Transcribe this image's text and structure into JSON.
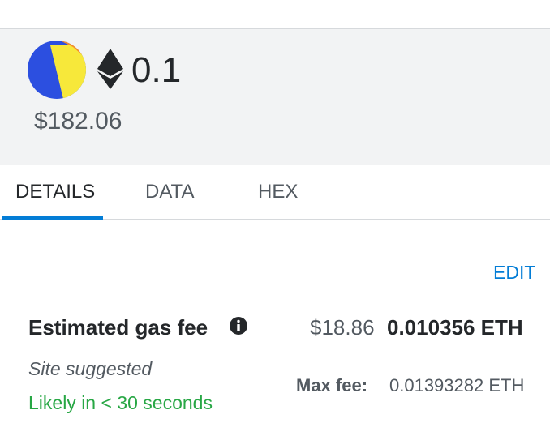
{
  "summary": {
    "eth_amount": "0.1",
    "fiat_amount": "$182.06",
    "avatar_icon": "jazzicon-avatar",
    "currency_icon": "ethereum-icon"
  },
  "tabs": [
    {
      "label": "DETAILS",
      "active": true
    },
    {
      "label": "DATA",
      "active": false
    },
    {
      "label": "HEX",
      "active": false
    }
  ],
  "details": {
    "edit_label": "EDIT",
    "gas_fee_title": "Estimated gas fee",
    "info_icon": "info-icon",
    "gas_fee_fiat": "$18.86",
    "gas_fee_eth": "0.010356 ETH",
    "site_suggested": "Site suggested",
    "likely_time": "Likely in < 30 seconds",
    "max_fee_label": "Max fee:",
    "max_fee_value": "0.01393282 ETH"
  },
  "colors": {
    "accent": "#037dd6",
    "success": "#28a745",
    "summary_bg": "#f2f3f4"
  }
}
